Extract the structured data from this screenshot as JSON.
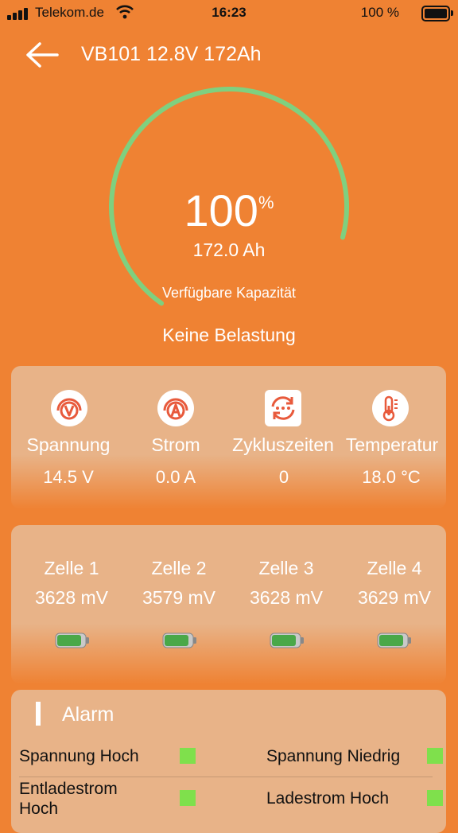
{
  "status_bar": {
    "carrier": "Telekom.de",
    "time": "16:23",
    "battery": "100 %"
  },
  "header": {
    "title": "VB101 12.8V 172Ah"
  },
  "gauge": {
    "percent": "100",
    "percent_symbol": "%",
    "level": 1.0,
    "capacity": "172.0 Ah",
    "label": "Verfügbare Kapazität",
    "color": "#7fd07f"
  },
  "load_status": "Keine Belastung",
  "metrics": [
    {
      "label": "Spannung",
      "value": "14.5 V",
      "icon": "voltage-icon"
    },
    {
      "label": "Strom",
      "value": "0.0 A",
      "icon": "current-icon"
    },
    {
      "label": "Zykluszeiten",
      "value": "0",
      "icon": "cycle-icon"
    },
    {
      "label": "Temperatur",
      "value": "18.0 °C",
      "icon": "thermometer-icon"
    }
  ],
  "cells": [
    {
      "label": "Zelle 1",
      "value": "3628 mV"
    },
    {
      "label": "Zelle 2",
      "value": "3579 mV"
    },
    {
      "label": "Zelle 3",
      "value": "3628 mV"
    },
    {
      "label": "Zelle 4",
      "value": "3629 mV"
    }
  ],
  "alarm": {
    "title": "Alarm",
    "items": [
      {
        "label": "Spannung Hoch",
        "color": "#7fe04c"
      },
      {
        "label": "Spannung Niedrig",
        "color": "#7fe04c"
      },
      {
        "label": "Entladestrom Hoch",
        "color": "#7fe04c"
      },
      {
        "label": "Ladestrom Hoch",
        "color": "#7fe04c"
      }
    ]
  },
  "colors": {
    "background": "#ef8233",
    "card": "#e8b388",
    "icon_accent": "#e85a3c",
    "ok": "#7fe04c"
  }
}
